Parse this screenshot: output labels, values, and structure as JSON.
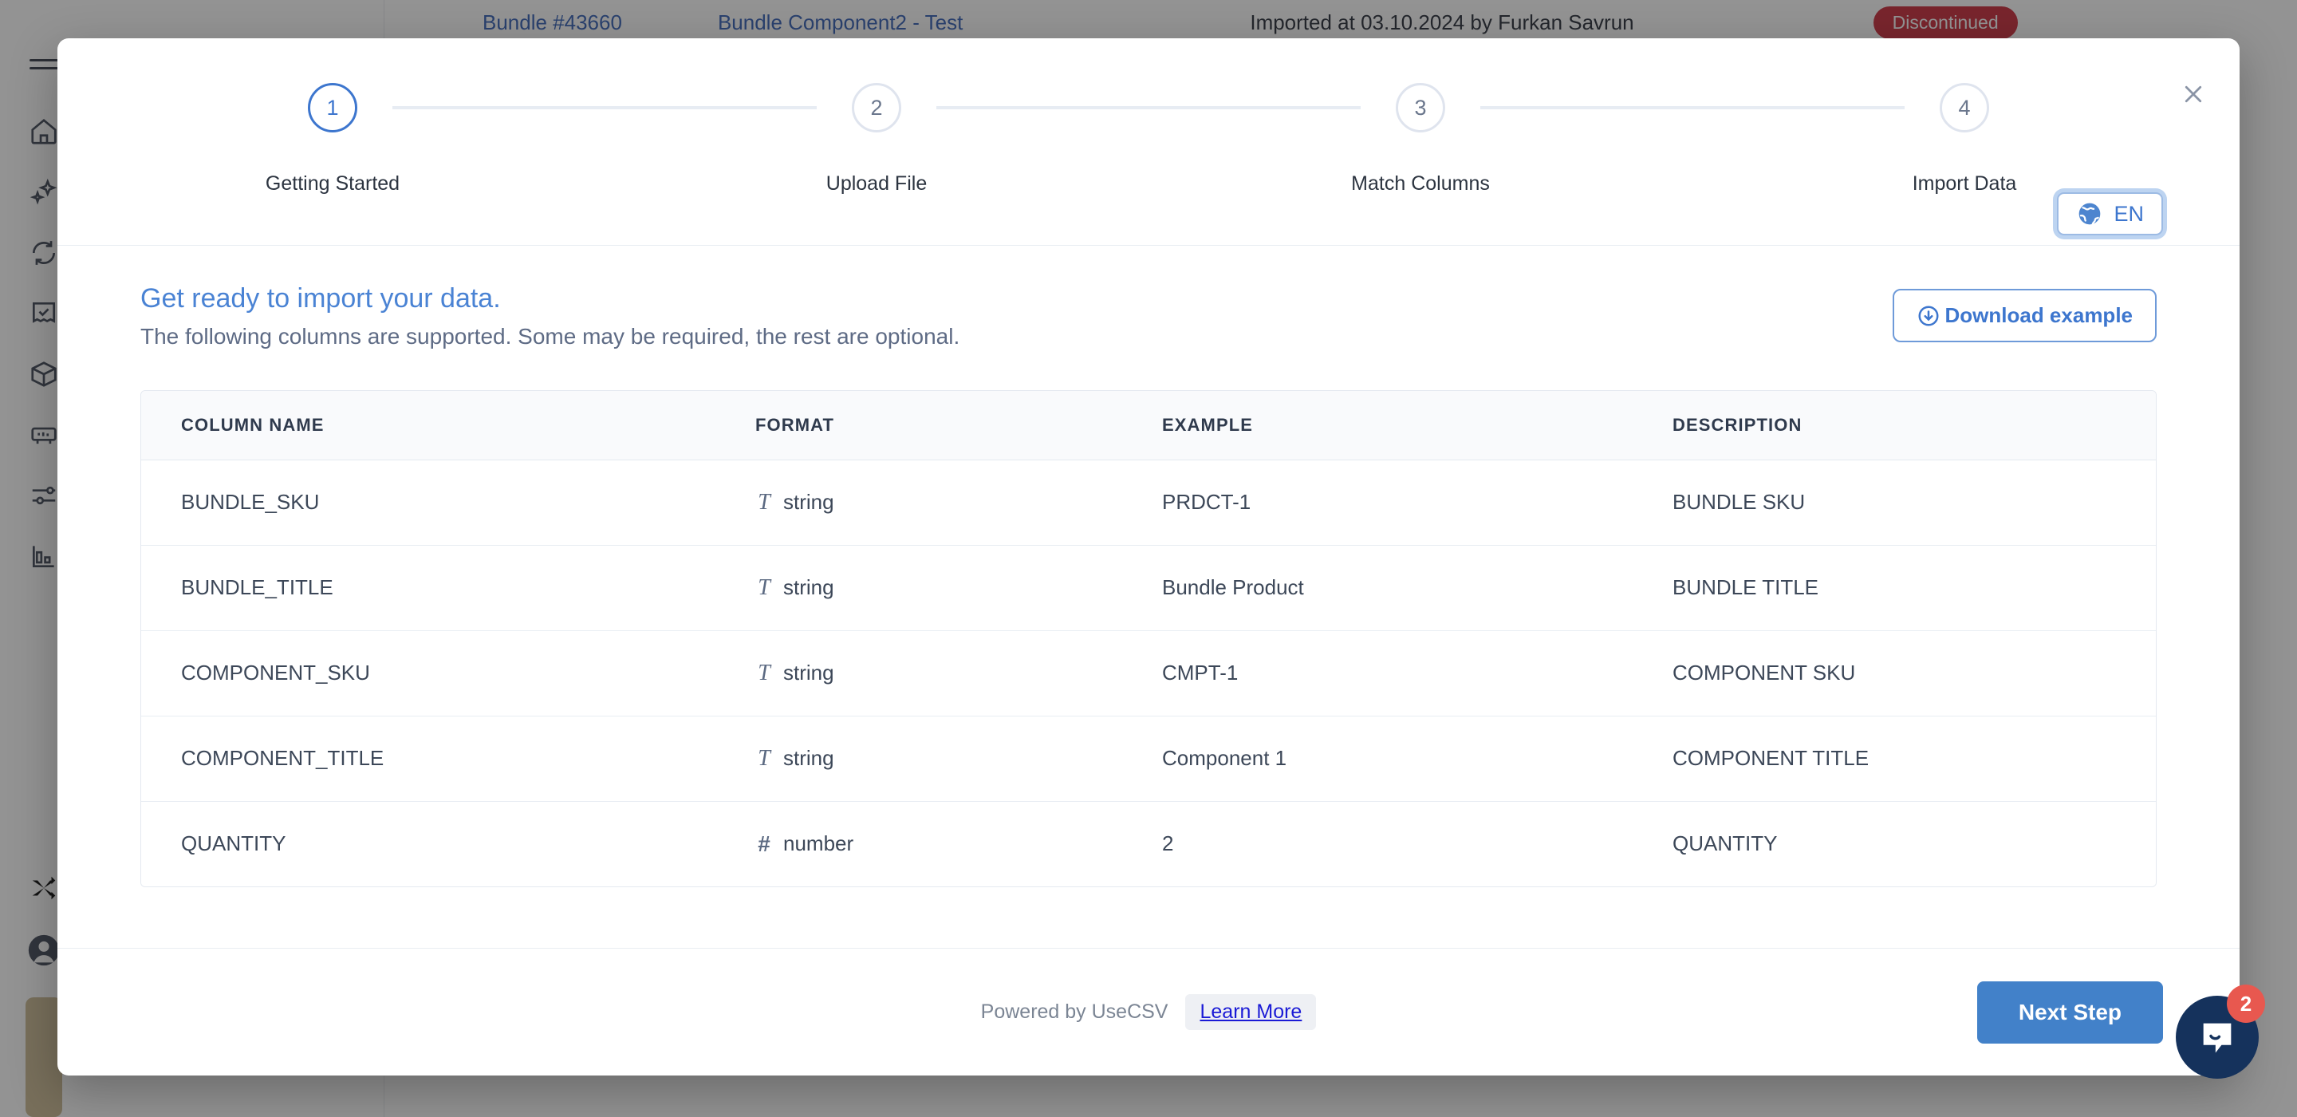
{
  "background": {
    "topbar": {
      "bundle_id": "Bundle #43660",
      "bundle_title": "Bundle Component2 - Test",
      "imported_info": "Imported at 03.10.2024 by Furkan Savrun",
      "status_badge": "Discontinued",
      "badge_color": "#c82333"
    },
    "sidebar": {
      "icons": [
        "home-icon",
        "sparkles-icon",
        "sync-icon",
        "receipt-check-icon",
        "package-icon",
        "label-printer-icon",
        "sliders-icon",
        "bar-chart-icon",
        "shuffle-icon"
      ],
      "avatar": "user-avatar-icon"
    }
  },
  "modal": {
    "close_label": "×",
    "language": {
      "code": "EN",
      "icon": "globe-icon"
    },
    "stepper": {
      "steps": [
        {
          "number": "1",
          "label": "Getting Started",
          "active": true
        },
        {
          "number": "2",
          "label": "Upload File",
          "active": false
        },
        {
          "number": "3",
          "label": "Match Columns",
          "active": false
        },
        {
          "number": "4",
          "label": "Import Data",
          "active": false
        }
      ]
    },
    "intro": {
      "title": "Get ready to import your data.",
      "subtitle": "The following columns are supported. Some may be required, the rest are optional.",
      "download_button": "Download example",
      "download_icon": "download-circle-icon"
    },
    "table": {
      "headers": [
        "COLUMN NAME",
        "FORMAT",
        "EXAMPLE",
        "DESCRIPTION"
      ],
      "rows": [
        {
          "name": "BUNDLE_SKU",
          "format": "string",
          "format_icon": "text-type-icon",
          "example": "PRDCT-1",
          "description": "BUNDLE SKU"
        },
        {
          "name": "BUNDLE_TITLE",
          "format": "string",
          "format_icon": "text-type-icon",
          "example": "Bundle Product",
          "description": "BUNDLE TITLE"
        },
        {
          "name": "COMPONENT_SKU",
          "format": "string",
          "format_icon": "text-type-icon",
          "example": "CMPT-1",
          "description": "COMPONENT SKU"
        },
        {
          "name": "COMPONENT_TITLE",
          "format": "string",
          "format_icon": "text-type-icon",
          "example": "Component 1",
          "description": "COMPONENT TITLE"
        },
        {
          "name": "QUANTITY",
          "format": "number",
          "format_icon": "number-type-icon",
          "example": "2",
          "description": "QUANTITY"
        }
      ]
    },
    "footer": {
      "powered_by": "Powered by UseCSV",
      "learn_more": "Learn More",
      "next_step": "Next Step",
      "next_step_color": "#4281c9"
    }
  },
  "chat": {
    "unread_count": "2",
    "icon": "chat-bubble-icon",
    "bubble_color": "#15325c",
    "badge_color": "#e8584f"
  }
}
